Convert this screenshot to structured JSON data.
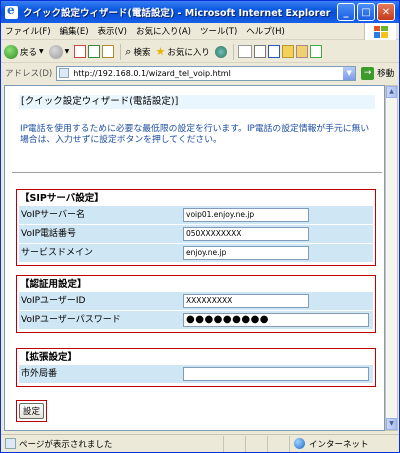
{
  "window": {
    "title": "クイック設定ウィザード(電話設定) - Microsoft Internet Explorer"
  },
  "menu": [
    "ファイル(F)",
    "編集(E)",
    "表示(V)",
    "お気に入り(A)",
    "ツール(T)",
    "ヘルプ(H)"
  ],
  "toolbar": {
    "back": "戻る",
    "search": "検索",
    "favorites": "お気に入り"
  },
  "address": {
    "label": "アドレス(D)",
    "url": "http://192.168.0.1/wizard_tel_voip.html",
    "go": "移動"
  },
  "page": {
    "heading": "[クイック設定ウィザード(電話設定)]",
    "description": "IP電話を使用するために必要な最低限の設定を行います。IP電話の設定情報が手元に無い場合は、入力せずに設定ボタンを押してください。",
    "sip": {
      "title": "【SIPサーバ設定】",
      "server_label": "VoIPサーバー名",
      "server_value": "voip01.enjoy.ne.jp",
      "number_label": "VoIP電話番号",
      "number_value": "050XXXXXXXX",
      "domain_label": "サービスドメイン",
      "domain_value": "enjoy.ne.jp"
    },
    "auth": {
      "title": "【認証用設定】",
      "user_label": "VoIPユーザーID",
      "user_value": "XXXXXXXXX",
      "pass_label": "VoIPユーザーパスワード",
      "pass_value": "●●●●●●●●●"
    },
    "ext": {
      "title": "【拡張設定】",
      "prefix_label": "市外局番",
      "prefix_value": ""
    },
    "submit": "設定"
  },
  "status": {
    "text": "ページが表示されました",
    "zone": "インターネット"
  }
}
